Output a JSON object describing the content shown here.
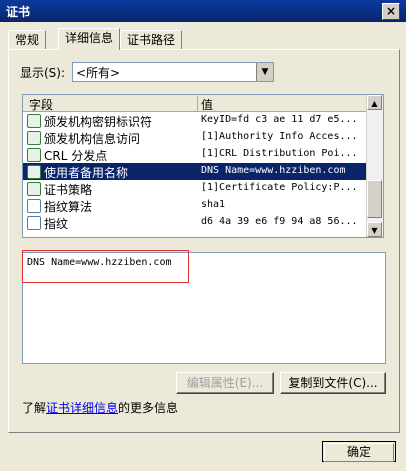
{
  "window": {
    "title": "证书",
    "close_glyph": "×"
  },
  "tabs": [
    {
      "label": "常规"
    },
    {
      "label": "详细信息"
    },
    {
      "label": "证书路径"
    }
  ],
  "show": {
    "label": "显示(S):",
    "value": "<所有>"
  },
  "list": {
    "col_field": "字段",
    "col_value": "值",
    "rows": [
      {
        "field": "颁发机构密钥标识符",
        "value": "KeyID=fd c3 ae 11 d7 e5...",
        "icon": "extension-icon"
      },
      {
        "field": "颁发机构信息访问",
        "value": "[1]Authority Info Acces...",
        "icon": "extension-icon"
      },
      {
        "field": "CRL 分发点",
        "value": "[1]CRL Distribution Poi...",
        "icon": "extension-icon"
      },
      {
        "field": "使用者备用名称",
        "value": "DNS Name=www.hzziben.com",
        "icon": "extension-icon",
        "selected": true
      },
      {
        "field": "证书策略",
        "value": "[1]Certificate Policy:P...",
        "icon": "extension-icon"
      },
      {
        "field": "指纹算法",
        "value": "sha1",
        "icon": "property-icon"
      },
      {
        "field": "指纹",
        "value": "d6 4a 39 e6 f9 94 a8 56...",
        "icon": "property-icon"
      }
    ]
  },
  "detail": {
    "text": "DNS Name=www.hzziben.com"
  },
  "buttons": {
    "edit": "编辑属性(E)...",
    "copy": "复制到文件(C)...",
    "ok": "确定"
  },
  "learn": {
    "prefix": "了解",
    "link": "证书详细信息",
    "suffix": "的更多信息"
  }
}
